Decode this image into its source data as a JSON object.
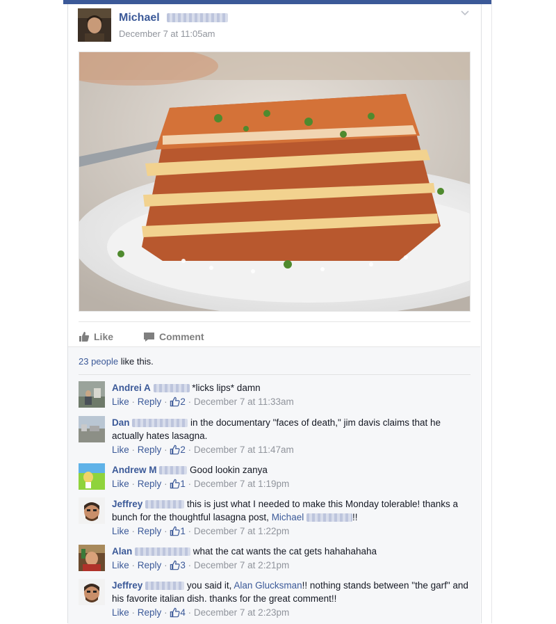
{
  "post": {
    "author_first": "Michael",
    "timestamp": "December 7 at 11:05am",
    "image_alt": "lasagna on a white plate"
  },
  "actions": {
    "like_label": "Like",
    "comment_label": "Comment"
  },
  "likes": {
    "people": "23 people",
    "suffix": " like this."
  },
  "comments": [
    {
      "name": "Andrei A",
      "text": "*licks lips* damn",
      "likes": "2",
      "time": "December 7 at 11:33am"
    },
    {
      "name": "Dan",
      "text": "in the documentary \"faces of death,\" jim davis claims that he actually hates lasagna.",
      "likes": "2",
      "time": "December 7 at 11:47am"
    },
    {
      "name": "Andrew M",
      "text": "Good lookin zanya",
      "likes": "1",
      "time": "December 7 at 1:19pm"
    },
    {
      "name": "Jeffrey",
      "text": "this is just what I needed to make this Monday tolerable! thanks a bunch for the thoughtful lasagna post,",
      "mention": "Michael",
      "after": "!!",
      "likes": "1",
      "time": "December 7 at 1:22pm"
    },
    {
      "name": "Alan",
      "text": "what the cat wants the cat gets hahahahaha",
      "likes": "3",
      "time": "December 7 at 2:21pm"
    },
    {
      "name": "Jeffrey",
      "text": "you said it,",
      "mention": "Alan Glucksman",
      "after": "!! nothing stands between \"the garf\" and his favorite italian dish. thanks for the great comment!!",
      "likes": "4",
      "time": "December 7 at 2:23pm"
    }
  ],
  "comment_actions": {
    "like": "Like",
    "reply": "Reply",
    "sep": "·"
  },
  "colors": {
    "brand": "#3b5998",
    "meta": "#90949c",
    "text": "#141823",
    "panel": "#f6f7f9"
  }
}
